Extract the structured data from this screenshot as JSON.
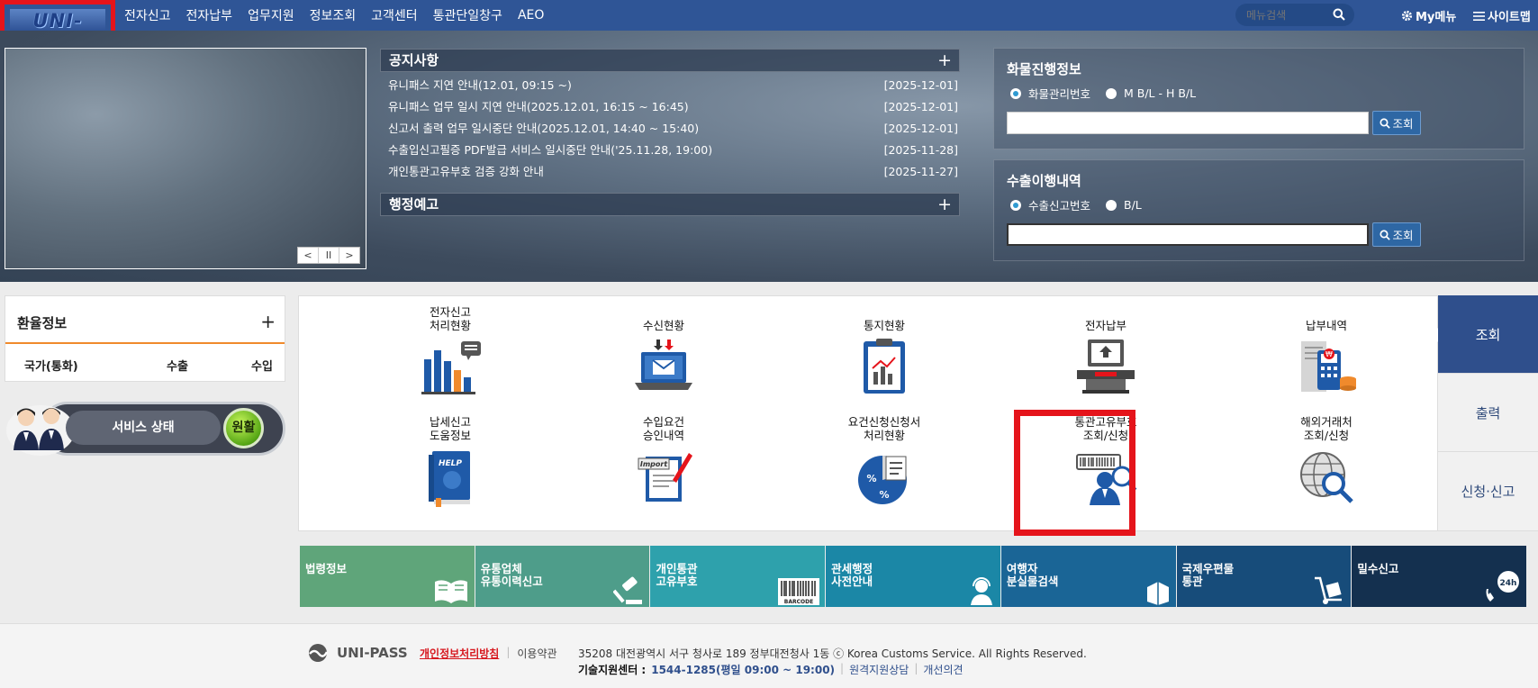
{
  "brand": {
    "logo_text": "UNI-PASS"
  },
  "nav": [
    "전자신고",
    "전자납부",
    "업무지원",
    "정보조회",
    "고객센터",
    "통관단일창구",
    "AEO"
  ],
  "menu_search": {
    "placeholder": "메뉴검색"
  },
  "util": {
    "my_menu": "My메뉴",
    "sitemap": "사이트맵"
  },
  "notice": {
    "title": "공지사항",
    "items": [
      {
        "text": "유니패스 지연 안내(12.01, 09:15 ~)",
        "date": "[2025-12-01]"
      },
      {
        "text": "유니패스 업무 일시 지연 안내(2025.12.01, 16:15 ~ 16:45)",
        "date": "[2025-12-01]"
      },
      {
        "text": "신고서 출력 업무 일시중단 안내(2025.12.01, 14:40 ~ 15:40)",
        "date": "[2025-12-01]"
      },
      {
        "text": "수출입신고필증 PDF발급 서비스 일시중단 안내('25.11.28, 19:00)",
        "date": "[2025-11-28]"
      },
      {
        "text": "개인통관고유부호 검증 강화 안내",
        "date": "[2025-11-27]"
      }
    ],
    "admin_title": "행정예고"
  },
  "slider_ctrl": {
    "prev": "<",
    "pause": "II",
    "next": ">"
  },
  "cargo": {
    "title": "화물진행정보",
    "opt1": "화물관리번호",
    "opt2": "M B/L - H B/L",
    "button": "조회",
    "value": ""
  },
  "export": {
    "title": "수출이행내역",
    "opt1": "수출신고번호",
    "opt2": "B/L",
    "button": "조회",
    "value": ""
  },
  "exchange": {
    "title": "환율정보",
    "col_country": "국가(통화)",
    "col_export": "수출",
    "col_import": "수입"
  },
  "service": {
    "label": "서비스 상태",
    "status": "원활"
  },
  "grid": [
    {
      "label": "전자신고\n처리현황",
      "icon": "chart-icon"
    },
    {
      "label": "수신현황",
      "icon": "inbox-laptop-icon"
    },
    {
      "label": "통지현황",
      "icon": "clipboard-chart-icon"
    },
    {
      "label": "전자납부",
      "icon": "payment-terminal-icon"
    },
    {
      "label": "납부내역",
      "icon": "receipt-calculator-icon"
    },
    {
      "label": "납세신고\n도움정보",
      "icon": "help-book-icon"
    },
    {
      "label": "수입요건\n승인내역",
      "icon": "import-document-icon"
    },
    {
      "label": "요건신청신청서\n처리현황",
      "icon": "percent-pie-icon"
    },
    {
      "label": "통관고유부호\n조회/신청",
      "icon": "barcode-person-icon"
    },
    {
      "label": "해외거래처\n조회/신청",
      "icon": "globe-search-icon"
    }
  ],
  "side_tabs": [
    "조회",
    "출력",
    "신청·신고"
  ],
  "tiles": [
    {
      "label": "법령정보",
      "color": "#5fa57a"
    },
    {
      "label": "유통업체\n유통이력신고",
      "color": "#4e9d8a"
    },
    {
      "label": "개인통관\n고유부호",
      "color": "#2ea1ac",
      "badge": "BARCODE"
    },
    {
      "label": "관세행정\n사전안내",
      "color": "#1b87a6"
    },
    {
      "label": "여행자\n분실물검색",
      "color": "#1a6596"
    },
    {
      "label": "국제우편물\n통관",
      "color": "#174c7a"
    },
    {
      "label": "밀수신고",
      "color": "#14304f",
      "badge": "24h"
    }
  ],
  "footer": {
    "logo": "UNI-PASS",
    "privacy": "개인정보처리방침",
    "terms": "이용약관",
    "address": "35208 대전광역시 서구 청사로 189 정부대전청사 1동 ⓒ Korea Customs Service. All Rights Reserved.",
    "tech_label": "기술지원센터 :",
    "tech_phone": "1544-1285(평일 09:00 ~ 19:00)",
    "remote": "원격지원상담",
    "feedback": "개선의견"
  },
  "colors": {
    "nav_bg": "#2f5596",
    "highlight": "#e5141b",
    "tab_active": "#2f4f8c",
    "exchange_line": "#f08a2c"
  }
}
